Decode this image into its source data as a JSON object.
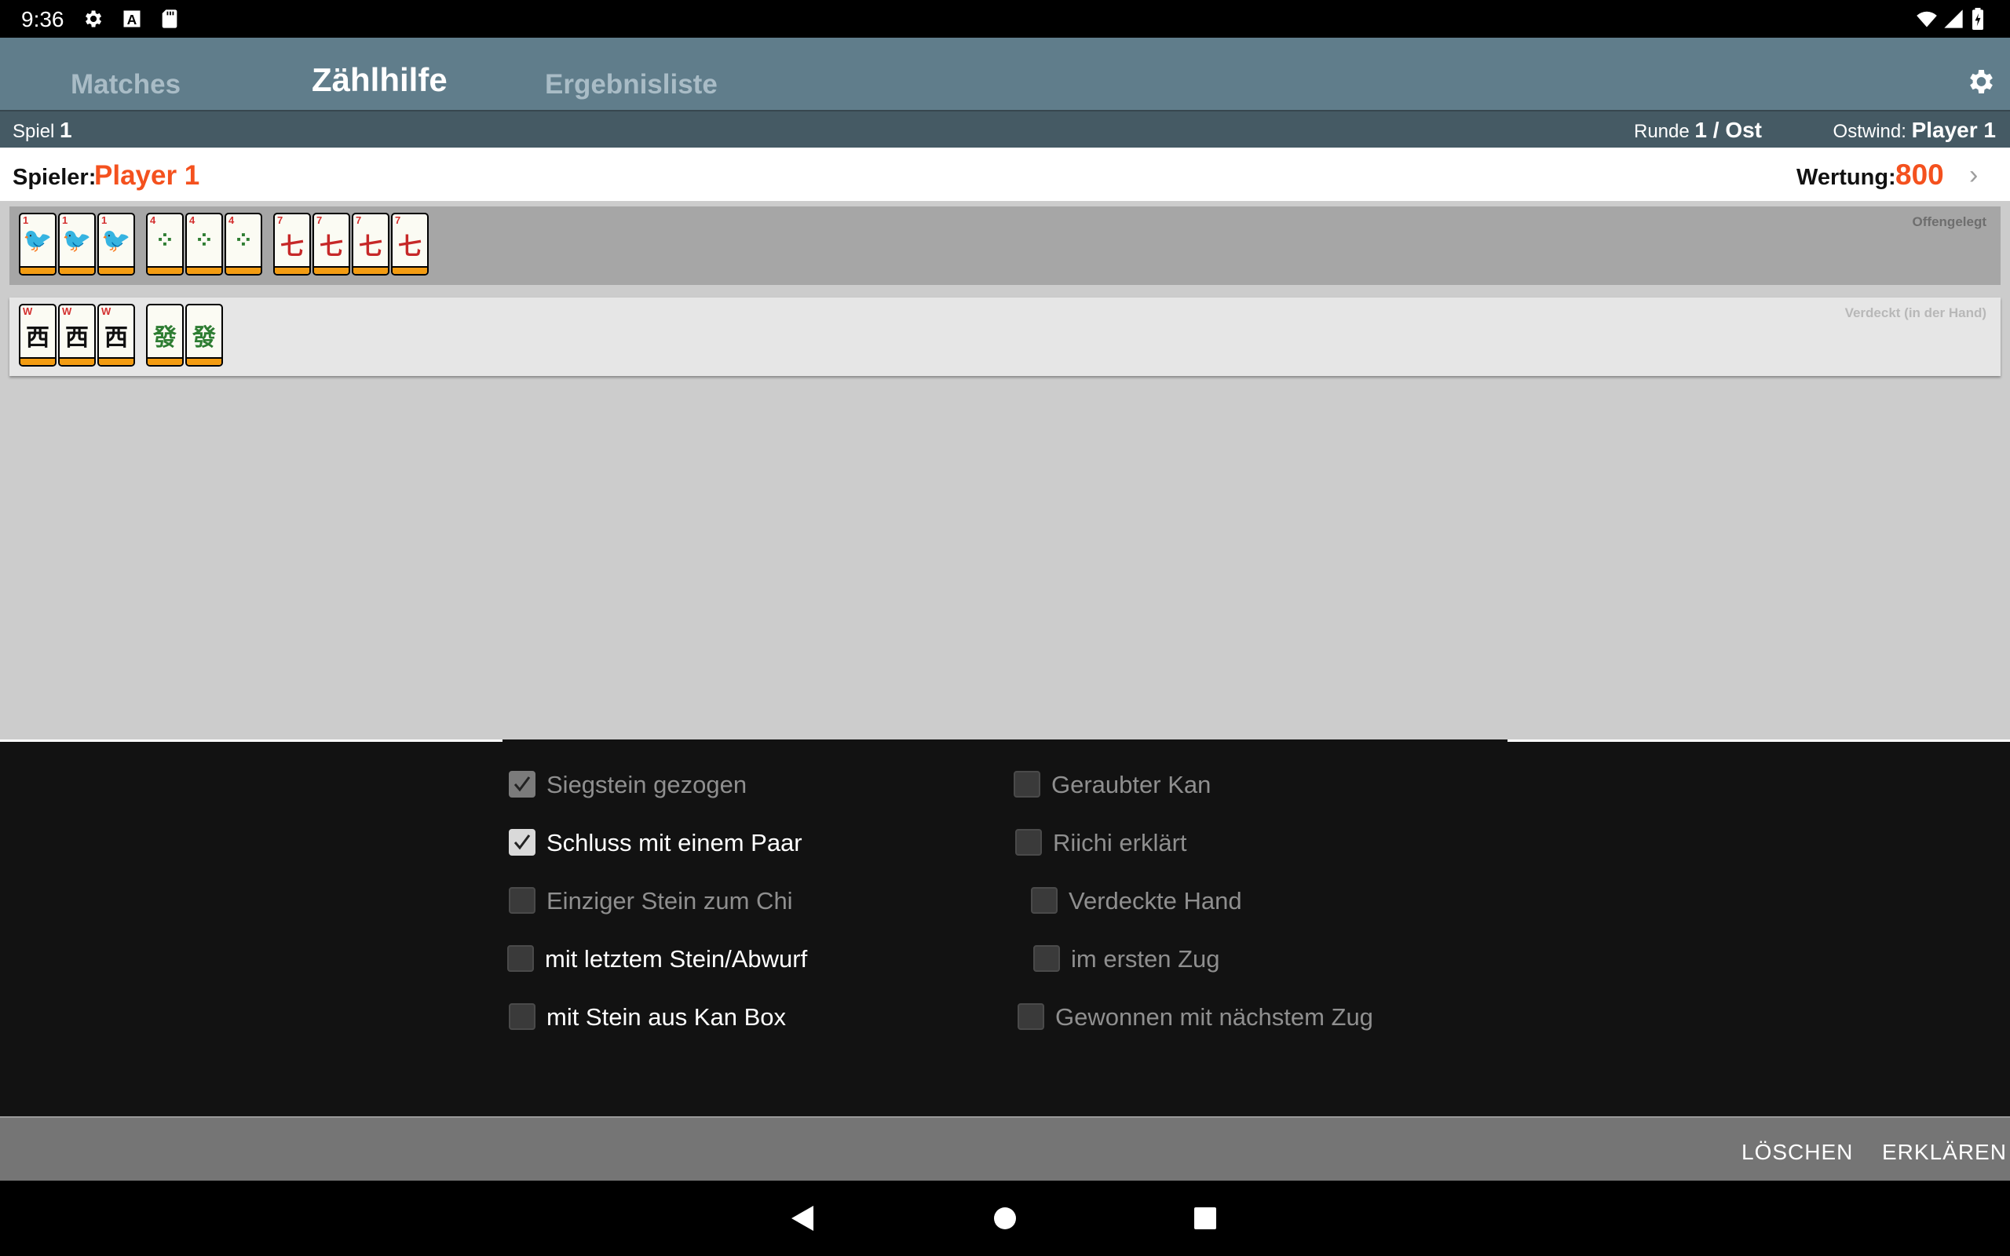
{
  "status_bar": {
    "time": "9:36",
    "icons": [
      "gear-icon",
      "a-icon",
      "sd-card-icon",
      "wifi-icon",
      "signal-icon",
      "battery-icon"
    ]
  },
  "tabs": [
    {
      "label": "Matches",
      "active": false
    },
    {
      "label": "Zählhilfe",
      "active": true
    },
    {
      "label": "Ergebnisliste",
      "active": false
    }
  ],
  "info_bar": {
    "spiel_label": "Spiel",
    "spiel_value": "1",
    "runde_label": "Runde",
    "runde_value": "1 / Ost",
    "ostwind_label": "Ostwind:",
    "ostwind_value": "Player 1"
  },
  "player": {
    "label": "Spieler:",
    "name": "Player 1",
    "wertung_label": "Wertung:",
    "wertung_value": "800"
  },
  "rows": {
    "open_label": "Offengelegt",
    "hidden_label": "Verdeckt (in der Hand)",
    "open_tiles": [
      {
        "num": "1",
        "glyph": "🐦",
        "color": "#2e7d32"
      },
      {
        "num": "1",
        "glyph": "🐦",
        "color": "#2e7d32"
      },
      {
        "num": "1",
        "glyph": "🐦",
        "color": "#2e7d32"
      },
      {
        "num": "4",
        "glyph": "⁘",
        "color": "#2e7d32"
      },
      {
        "num": "4",
        "glyph": "⁘",
        "color": "#2e7d32"
      },
      {
        "num": "4",
        "glyph": "⁘",
        "color": "#2e7d32"
      },
      {
        "num": "7",
        "glyph": "七",
        "color": "#c62828"
      },
      {
        "num": "7",
        "glyph": "七",
        "color": "#c62828"
      },
      {
        "num": "7",
        "glyph": "七",
        "color": "#c62828"
      },
      {
        "num": "7",
        "glyph": "七",
        "color": "#c62828"
      }
    ],
    "hidden_tiles": [
      {
        "num": "W",
        "glyph": "西",
        "color": "#111111"
      },
      {
        "num": "W",
        "glyph": "西",
        "color": "#111111"
      },
      {
        "num": "W",
        "glyph": "西",
        "color": "#111111"
      },
      {
        "num": "",
        "glyph": "發",
        "color": "#2e7d32"
      },
      {
        "num": "",
        "glyph": "發",
        "color": "#2e7d32"
      }
    ]
  },
  "options_left": [
    {
      "label": "Siegstein gezogen",
      "checked": true,
      "enabled": false
    },
    {
      "label": "Schluss mit einem Paar",
      "checked": true,
      "enabled": true
    },
    {
      "label": "Einziger Stein zum Chi",
      "checked": false,
      "enabled": false
    },
    {
      "label": "mit letztem Stein/Abwurf",
      "checked": false,
      "enabled": true
    },
    {
      "label": "mit Stein aus Kan Box",
      "checked": false,
      "enabled": true
    }
  ],
  "options_right": [
    {
      "label": "Geraubter Kan",
      "checked": false,
      "enabled": false
    },
    {
      "label": "Riichi erklärt",
      "checked": false,
      "enabled": false
    },
    {
      "label": "Verdeckte Hand",
      "checked": false,
      "enabled": false
    },
    {
      "label": "im ersten Zug",
      "checked": false,
      "enabled": false
    },
    {
      "label": "Gewonnen mit nächstem Zug",
      "checked": false,
      "enabled": false
    }
  ],
  "actions": {
    "clear": "LÖSCHEN",
    "explain": "ERKLÄREN"
  },
  "colors": {
    "appbar": "#607d8b",
    "infobar": "#455a64",
    "accent": "#f4511e",
    "tile_base": "#f39c12"
  }
}
